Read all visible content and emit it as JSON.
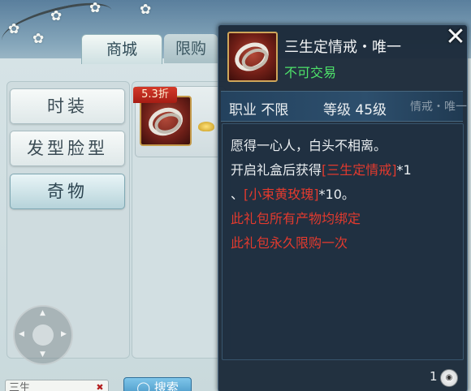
{
  "shop": {
    "tabs": [
      {
        "label": "商城",
        "active": true
      },
      {
        "label": "限购",
        "active": false
      }
    ],
    "categories": [
      {
        "label": "时装",
        "active": false
      },
      {
        "label": "发型脸型",
        "active": false
      },
      {
        "label": "奇物",
        "active": true
      }
    ],
    "item": {
      "discount": "5.3折"
    },
    "search_input_value": "三生",
    "search_button": "搜索"
  },
  "tooltip": {
    "title": "三生定情戒・唯一",
    "subtitle": "不可交易",
    "ghost_title": "情戒・唯一",
    "stats": {
      "job_key": "职业",
      "job_value": "不限",
      "level_key": "等级",
      "level_value": "45级"
    },
    "description": {
      "line1": "愿得一心人，白头不相离。",
      "line2_prefix": "开启礼盒后获得",
      "line2_item": "[三生定情戒]",
      "line2_suffix": "*1",
      "line3_prefix": "、",
      "line3_item": "[小束黄玫瑰]",
      "line3_suffix": "*10。",
      "line4": "此礼包所有产物均绑定",
      "line5": "此礼包永久限购一次"
    },
    "footer_count": "1",
    "close_icon": "close-icon",
    "colors": {
      "title": "#f2f4f5",
      "subtitle": "#4ee36a",
      "highlight": "#e23a2e",
      "panel": "#1b2a39"
    }
  }
}
